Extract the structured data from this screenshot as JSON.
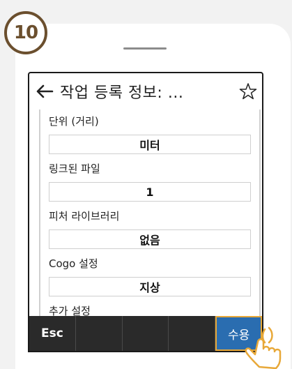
{
  "step": {
    "number": "10"
  },
  "header": {
    "back_icon": "back-arrow-icon",
    "title": "작업 등록 정보: ...",
    "star_icon": "star-outline-icon"
  },
  "fields": [
    {
      "label": "단위 (거리)",
      "value": "미터"
    },
    {
      "label": "링크된 파일",
      "value": "1"
    },
    {
      "label": "피처 라이브러리",
      "value": "없음"
    },
    {
      "label": "Cogo 설정",
      "value": "지상"
    },
    {
      "label": "추가 설정",
      "value": ""
    }
  ],
  "softkeys": [
    "Esc",
    "",
    "",
    "",
    "수용"
  ],
  "colors": {
    "badge_border": "#6b4f2e",
    "softkey_bar": "#2a2a2a",
    "accept_button": "#2a6db0",
    "highlight": "#e8a838"
  },
  "pointer": {
    "icon": "tap-hand-icon"
  }
}
